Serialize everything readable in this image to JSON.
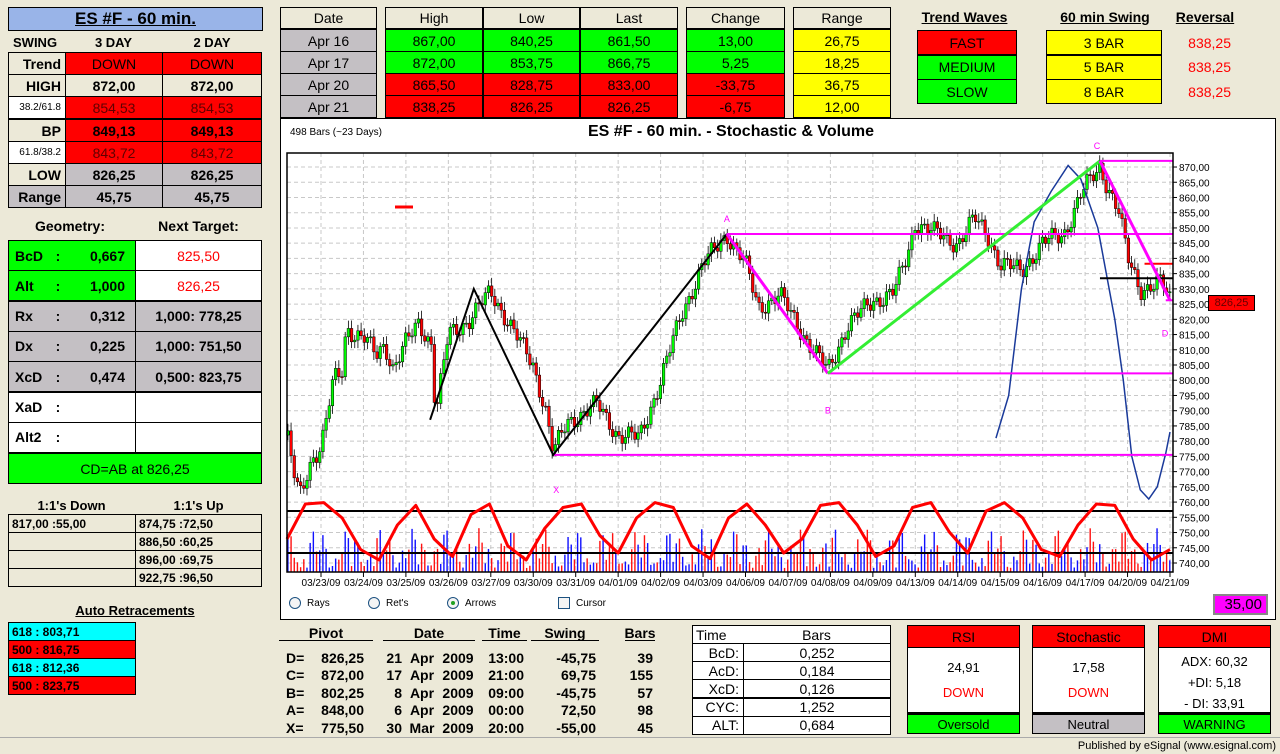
{
  "title": "ES #F - 60 min.",
  "swing": {
    "label": "SWING",
    "columns": [
      "3 DAY",
      "2 DAY"
    ],
    "rows": [
      {
        "label": "Trend",
        "values": [
          "DOWN",
          "DOWN"
        ],
        "style": "trend"
      },
      {
        "label": "HIGH",
        "values": [
          "872,00",
          "872,00"
        ],
        "style": "high"
      },
      {
        "label": "38.2/61.8",
        "values": [
          "854,53",
          "854,53"
        ],
        "style": "fib"
      },
      {
        "label": "BP",
        "values": [
          "849,13",
          "849,13"
        ],
        "style": "bp"
      },
      {
        "label": "61.8/38.2",
        "values": [
          "843,72",
          "843,72"
        ],
        "style": "fib"
      },
      {
        "label": "LOW",
        "values": [
          "826,25",
          "826,25"
        ],
        "style": "low"
      },
      {
        "label": "Range",
        "values": [
          "45,75",
          "45,75"
        ],
        "style": "range"
      }
    ]
  },
  "geometry": {
    "header_left": "Geometry:",
    "header_right": "Next Target:",
    "rows": [
      {
        "label": "BcD",
        "value": "0,667",
        "target": "825,50",
        "state": "green"
      },
      {
        "label": "Alt",
        "value": "1,000",
        "target": "826,25",
        "state": "green"
      },
      {
        "label": "Rx",
        "value": "0,312",
        "target": "1,000: 778,25",
        "state": "gray"
      },
      {
        "label": "Dx",
        "value": "0,225",
        "target": "1,000: 751,50",
        "state": "gray"
      },
      {
        "label": "XcD",
        "value": "0,474",
        "target": "0,500: 823,75",
        "state": "gray"
      },
      {
        "label": "XaD",
        "value": "",
        "target": "",
        "state": "white"
      },
      {
        "label": "Alt2",
        "value": "",
        "target": "",
        "state": "white"
      }
    ],
    "footer": "CD=AB at 826,25"
  },
  "one_to_one": {
    "down_header": "1:1's Down",
    "up_header": "1:1's Up",
    "down": [
      "817,00 :55,00",
      "",
      "",
      ""
    ],
    "up": [
      "874,75 :72,50",
      "886,50 :60,25",
      "896,00 :69,75",
      "922,75 :96,50"
    ]
  },
  "auto_retracements": {
    "title": "Auto Retracements",
    "items": [
      {
        "text": "618 : 803,71",
        "color": "#00ffff"
      },
      {
        "text": "500 : 816,75",
        "color": "#ff0000"
      },
      {
        "text": "618 : 812,36",
        "color": "#00ffff"
      },
      {
        "text": "500 : 823,75",
        "color": "#ff0000"
      }
    ]
  },
  "quotes": {
    "headers": [
      "Date",
      "High",
      "Low",
      "Last",
      "Change",
      "Range"
    ],
    "rows": [
      {
        "date": "Apr  16",
        "high": "867,00",
        "low": "840,25",
        "last": "861,50",
        "change": "13,00",
        "range": "26,75",
        "dir": "up"
      },
      {
        "date": "Apr  17",
        "high": "872,00",
        "low": "853,75",
        "last": "866,75",
        "change": "5,25",
        "range": "18,25",
        "dir": "up"
      },
      {
        "date": "Apr  20",
        "high": "865,50",
        "low": "828,75",
        "last": "833,00",
        "change": "-33,75",
        "range": "36,75",
        "dir": "down"
      },
      {
        "date": "Apr  21",
        "high": "838,25",
        "low": "826,25",
        "last": "826,25",
        "change": "-6,75",
        "range": "12,00",
        "dir": "down"
      }
    ]
  },
  "trend_waves": {
    "header": "Trend Waves",
    "swing_header": "60 min Swing",
    "reversal_header": "Reversal",
    "rows": [
      {
        "wave": "FAST",
        "wave_color": "#ff0000",
        "swing": "3 BAR",
        "reversal": "838,25"
      },
      {
        "wave": "MEDIUM",
        "wave_color": "#00ff00",
        "swing": "5 BAR",
        "reversal": "838,25"
      },
      {
        "wave": "SLOW",
        "wave_color": "#00ff00",
        "swing": "8 BAR",
        "reversal": "838,25"
      }
    ]
  },
  "chart": {
    "bars_info": "498 Bars (~23 Days)",
    "title": "ES #F - 60 min. - Stochastic & Volume",
    "last_price_label": "826,25",
    "indicator_value": "35,00",
    "options": [
      {
        "label": "Rays",
        "type": "radio",
        "checked": false
      },
      {
        "label": "Ret's",
        "type": "radio",
        "checked": false
      },
      {
        "label": "Arrows",
        "type": "radio",
        "checked": true
      },
      {
        "label": "Cursor",
        "type": "checkbox",
        "checked": false
      }
    ]
  },
  "chart_data": {
    "type": "candlestick",
    "title": "ES #F - 60 min. - Stochastic & Volume",
    "ylim": [
      740,
      870
    ],
    "y_ticks": [
      "740,00",
      "745,00",
      "750,00",
      "755,00",
      "760,00",
      "765,00",
      "770,00",
      "775,00",
      "780,00",
      "785,00",
      "790,00",
      "795,00",
      "800,00",
      "805,00",
      "810,00",
      "815,00",
      "820,00",
      "825,00",
      "830,00",
      "835,00",
      "840,00",
      "845,00",
      "850,00",
      "855,00",
      "860,00",
      "865,00",
      "870,00"
    ],
    "x_ticks": [
      "03/23/09",
      "03/24/09",
      "03/25/09",
      "03/26/09",
      "03/27/09",
      "03/30/09",
      "03/31/09",
      "04/01/09",
      "04/02/09",
      "04/03/09",
      "04/06/09",
      "04/07/09",
      "04/08/09",
      "04/09/09",
      "04/13/09",
      "04/14/09",
      "04/15/09",
      "04/16/09",
      "04/17/09",
      "04/20/09",
      "04/21/09"
    ],
    "grid": true,
    "price_path_approx": [
      [
        -0.8,
        782
      ],
      [
        -0.6,
        766
      ],
      [
        -0.5,
        762
      ],
      [
        -0.2,
        775
      ],
      [
        0,
        778
      ],
      [
        0.3,
        800
      ],
      [
        0.5,
        803
      ],
      [
        0.6,
        818
      ],
      [
        0.8,
        815
      ],
      [
        1,
        814
      ],
      [
        1.3,
        808
      ],
      [
        1.5,
        812
      ],
      [
        1.7,
        804
      ],
      [
        2,
        812
      ],
      [
        2.3,
        819
      ],
      [
        2.6,
        812
      ],
      [
        2.7,
        788
      ],
      [
        3,
        815
      ],
      [
        3.5,
        820
      ],
      [
        4,
        829
      ],
      [
        4.3,
        822
      ],
      [
        4.7,
        812
      ],
      [
        5,
        805
      ],
      [
        5.3,
        790
      ],
      [
        5.47,
        776
      ],
      [
        5.8,
        786
      ],
      [
        6,
        788
      ],
      [
        6.5,
        792
      ],
      [
        7,
        782
      ],
      [
        7.5,
        781
      ],
      [
        8,
        800
      ],
      [
        8.5,
        822
      ],
      [
        9,
        838
      ],
      [
        9.56,
        848
      ],
      [
        10,
        838
      ],
      [
        10.3,
        824
      ],
      [
        10.8,
        828
      ],
      [
        11.5,
        812
      ],
      [
        11.94,
        803
      ],
      [
        12.4,
        818
      ],
      [
        13,
        826
      ],
      [
        13.5,
        829
      ],
      [
        13.8,
        840
      ],
      [
        14,
        852
      ],
      [
        14.5,
        848
      ],
      [
        15,
        845
      ],
      [
        15.4,
        853
      ],
      [
        15.7,
        848
      ],
      [
        16,
        838
      ],
      [
        16.5,
        836
      ],
      [
        17,
        845
      ],
      [
        17.5,
        848
      ],
      [
        17.9,
        861
      ],
      [
        18.35,
        870
      ],
      [
        18.8,
        855
      ],
      [
        19,
        840
      ],
      [
        19.3,
        830
      ],
      [
        19.8,
        832
      ],
      [
        20,
        826.25
      ]
    ],
    "pattern_pivots": [
      {
        "label": "X",
        "price": 775.5,
        "day": 5.47
      },
      {
        "label": "A",
        "price": 848.0,
        "day": 9.56
      },
      {
        "label": "B",
        "price": 802.25,
        "day": 11.94
      },
      {
        "label": "C",
        "price": 872.0,
        "day": 18.35
      },
      {
        "label": "D",
        "price": 826.25,
        "day": 20.0
      }
    ],
    "zigzag_black": [
      [
        2.57,
        787
      ],
      [
        3.6,
        830
      ],
      [
        5.47,
        775.5
      ],
      [
        9.56,
        848
      ]
    ],
    "levels_magenta": [
      {
        "price": 872,
        "from": 18.35
      },
      {
        "price": 848,
        "from": 9.56
      },
      {
        "price": 802.25,
        "from": 11.94
      },
      {
        "price": 775.5,
        "from": 5.47
      },
      {
        "price": 826.25,
        "from": 19.9
      }
    ],
    "level_red": 838.25,
    "level_black": 833.5,
    "overlay_blue": [
      [
        15.9,
        781
      ],
      [
        16.2,
        795
      ],
      [
        16.5,
        830
      ],
      [
        16.8,
        852
      ],
      [
        17.2,
        862
      ],
      [
        17.6,
        870.5
      ],
      [
        17.9,
        866
      ],
      [
        18.3,
        850
      ],
      [
        18.7,
        820
      ],
      [
        18.9,
        800
      ],
      [
        19.1,
        775
      ],
      [
        19.3,
        764
      ],
      [
        19.5,
        761
      ],
      [
        19.7,
        765
      ],
      [
        19.9,
        776
      ],
      [
        20,
        783
      ]
    ],
    "stochastic_levels": [
      80,
      20
    ],
    "stochastic": [
      40,
      90,
      92,
      70,
      25,
      10,
      60,
      88,
      40,
      15,
      75,
      90,
      30,
      10,
      55,
      85,
      90,
      45,
      20,
      70,
      92,
      85,
      30,
      12,
      70,
      90,
      60,
      20,
      40,
      88,
      92,
      60,
      15,
      30,
      85,
      92,
      50,
      20,
      80,
      92,
      70,
      25,
      15,
      60,
      90,
      88,
      40,
      10,
      25
    ]
  },
  "pivots": {
    "headers": [
      "Pivot",
      "Date",
      "Time",
      "Swing",
      "Bars"
    ],
    "rows": [
      {
        "name": "D=",
        "price": "826,25",
        "day": "21",
        "month": "Apr",
        "year": "2009",
        "time": "13:00",
        "swing": "-45,75",
        "bars": "39"
      },
      {
        "name": "C=",
        "price": "872,00",
        "day": "17",
        "month": "Apr",
        "year": "2009",
        "time": "21:00",
        "swing": "69,75",
        "bars": "155"
      },
      {
        "name": "B=",
        "price": "802,25",
        "day": "8",
        "month": "Apr",
        "year": "2009",
        "time": "09:00",
        "swing": "-45,75",
        "bars": "57"
      },
      {
        "name": "A=",
        "price": "848,00",
        "day": "6",
        "month": "Apr",
        "year": "2009",
        "time": "00:00",
        "swing": "72,50",
        "bars": "98"
      },
      {
        "name": "X=",
        "price": "775,50",
        "day": "30",
        "month": "Mar",
        "year": "2009",
        "time": "20:00",
        "swing": "-55,00",
        "bars": "45"
      }
    ]
  },
  "time_bars": {
    "headers": [
      "Time",
      "Bars"
    ],
    "rows": [
      {
        "label": "BcD:",
        "value": "0,252"
      },
      {
        "label": "AcD:",
        "value": "0,184"
      },
      {
        "label": "XcD:",
        "value": "0,126"
      },
      {
        "label": "CYC:",
        "value": "1,252"
      },
      {
        "label": "ALT:",
        "value": "0,684"
      }
    ]
  },
  "indicators": [
    {
      "name": "RSI",
      "value": "24,91",
      "direction": "DOWN",
      "status": "Oversold",
      "status_color": "#00ff00"
    },
    {
      "name": "Stochastic",
      "value": "17,58",
      "direction": "DOWN",
      "status": "Neutral",
      "status_color": "#c4c0c4"
    },
    {
      "name": "DMI",
      "lines": [
        "ADX:  60,32",
        "+DI:  5,18",
        "- DI:  33,91"
      ],
      "status": "WARNING",
      "status_color": "#00ff00"
    }
  ],
  "status_bar": "Published by eSignal (www.esignal.com)"
}
